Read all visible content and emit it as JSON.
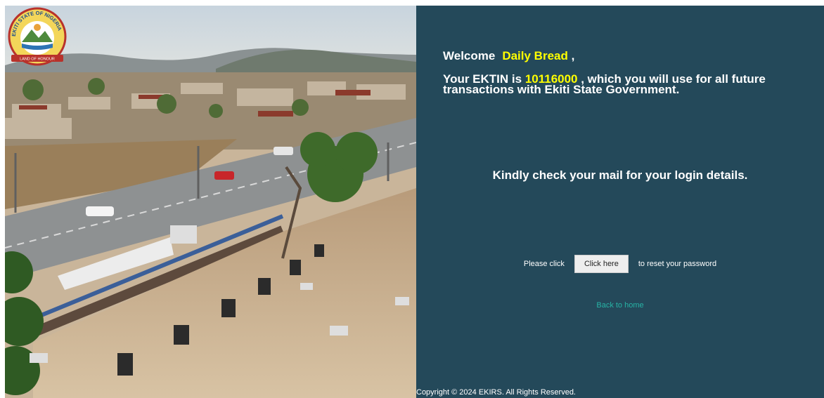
{
  "seal": {
    "arc_text": "EKITI STATE OF NIGERIA",
    "motto": "LAND OF HONOUR"
  },
  "welcome": {
    "prefix": "Welcome",
    "name": "Daily Bread",
    "suffix": ","
  },
  "ektin": {
    "prefix": "Your EKTIN is ",
    "value": "10116000",
    "suffix": " , which you will use for all future transactions with Ekiti State Government."
  },
  "mail_message": "Kindly check your mail for your login details.",
  "reset": {
    "prefix": "Please click",
    "button_label": "Click here",
    "suffix": "to reset your password"
  },
  "back_link": "Back to home",
  "copyright": "Copyright © 2024 EKIRS. All Rights Reserved.",
  "colors": {
    "panel_bg": "#24495a",
    "highlight": "#ffff00",
    "link": "#27b3a5"
  }
}
